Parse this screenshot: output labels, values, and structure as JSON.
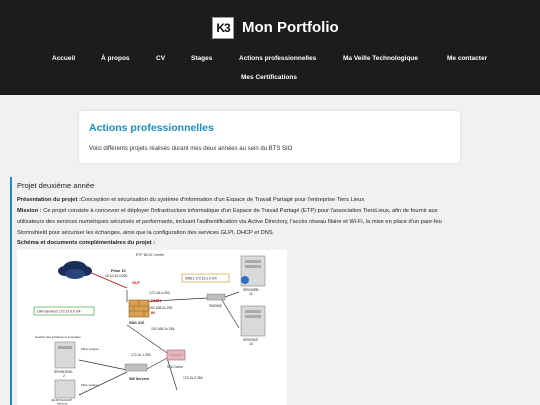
{
  "header": {
    "logo": "K3",
    "brand": "Mon Portfolio",
    "nav": [
      "Accueil",
      "À propos",
      "CV",
      "Stages",
      "Actions professionnelles",
      "Ma Veille Technologique",
      "Me contacter",
      "Mes Certifications"
    ]
  },
  "intro": {
    "title": "Actions professionnelles",
    "text": "Voici différents projets réalisés durant mes deux années au sein du BTS SIO"
  },
  "project": {
    "title": "Projet deuxième année",
    "presentation_label": "Présentation du projet :",
    "presentation_text": "Conception et sécurisation du système d'information d'un Espace de Travail Partagé pour l'entreprise Tiers Lieux",
    "mission_label": "Mission :",
    "mission_text_1": " Ce projet consiste à concevoir et déployer l'infrastructure informatique d'un Espace de Travail Partagé (ETP) pour l'association TiersLieux, afin de fournir aux",
    "mission_text_2": "utilisateurs des services numériques sécurisés et performants, incluant l'authentification via Active Directory, l'accès réseau filaire et Wi-Fi, la mise en place d'un pare-feu",
    "mission_text_3": "Stormshield pour sécuriser les échanges, ainsi que la configuration des services GLPI, DHCP et DNS.",
    "schema_label": "Schéma et documents complémentaires du projet :"
  },
  "diagram": {
    "title": "ETP NICE Centre",
    "prise": "Prise 10",
    "prise_ip": "10.10.10.x/260",
    "out": "OUT",
    "ip_fw_out": "172.16.x.253",
    "dmz_box": "DMZ1 172.16.x.0 /24",
    "dmz": "DMZ1",
    "ip_fw_dmz": "192.168.2x.253",
    "in": "IN",
    "fw": "SNS 310",
    "lan_box": "LAN Serveurs 172.2x.0.0 /24",
    "ip_sw1": "192.168.2x.254",
    "ip_sw2": "172.2x.1.254",
    "ip_sw3": "172.2x.2.254",
    "srvweb": "SRVWEB",
    "srvweb_id": "11",
    "swdmz": "SWDMZ",
    "srvdns": "SRVDNS",
    "srvdns_id": "13",
    "gestion": "Gestion des incidents et inventaire",
    "srvhdesk": "SRVHDESK",
    "srvhdesk_id": "2",
    "fibre1": "Fibre optique",
    "sw_servers": "SW Servers",
    "sw_coeur": "SW-Coeur",
    "fibre2": "Fibre optique",
    "srvad": "AD-DNS-DHCP",
    "srvad_id": "Serveur"
  }
}
